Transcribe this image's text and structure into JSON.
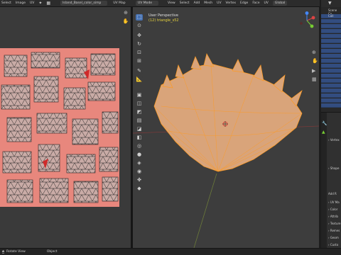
{
  "uv_header": {
    "menus": [
      "Select",
      "Image",
      "UV"
    ],
    "image_name": "Island_Basel_color_simp",
    "view_label": "UV Map"
  },
  "viewport_header": {
    "mode": "UV Mode",
    "menus": [
      "View",
      "Select",
      "Add",
      "Mesh",
      "UV",
      "Vertex",
      "Edge",
      "Face",
      "UV"
    ],
    "transform": "Global"
  },
  "viewport_overlay": {
    "view_name": "User Perspective",
    "object_name": "(12) triangle_s52"
  },
  "properties": {
    "tabs": [
      "Vertex",
      "Shape",
      "UV Ma",
      "Color",
      "Attrib",
      "Texture",
      "Remes",
      "Geom",
      "Custo"
    ],
    "add_label": "Add R"
  },
  "outliner": {
    "header": "Scene Co",
    "row_label": "Coll"
  },
  "status_bar": {
    "left": "Rotate View",
    "mid": "Object"
  },
  "colors": {
    "accent": "#4772b3",
    "selection": "#ff9a1f",
    "texture": "#e8877d"
  }
}
